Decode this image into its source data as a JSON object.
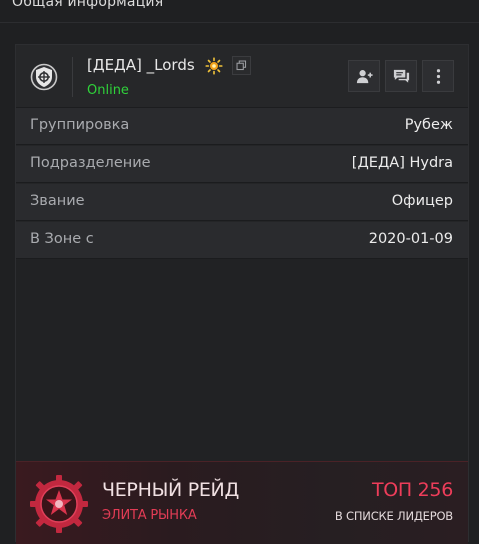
{
  "section": {
    "title": "Общая информация"
  },
  "profile": {
    "name": "[ДЕДА] _Lords",
    "status": "Online",
    "status_color": "#2fd23a",
    "emblem_icon": "shield-crosshair-icon",
    "badge_icon": "sun-badge-icon",
    "copy_icon": "copy-icon",
    "actions": [
      {
        "name": "add-friend",
        "icon": "person-plus-icon"
      },
      {
        "name": "message",
        "icon": "chat-icon"
      },
      {
        "name": "more",
        "icon": "kebab-menu-icon"
      }
    ]
  },
  "info": [
    {
      "label": "Группировка",
      "value": "Рубеж"
    },
    {
      "label": "Подразделение",
      "value": "[ДЕДА] Hydra"
    },
    {
      "label": "Звание",
      "value": "Офицер"
    },
    {
      "label": "В Зоне с",
      "value": "2020-01-09"
    }
  ],
  "raid": {
    "title": "ЧЕРНЫЙ РЕЙД",
    "subtitle": "ЭЛИТА РЫНКА",
    "rank": "ТОП 256",
    "rank_caption": "В СПИСКЕ ЛИДЕРОВ",
    "accent_color": "#e23c55",
    "emblem_icon": "black-raid-emblem-icon"
  }
}
